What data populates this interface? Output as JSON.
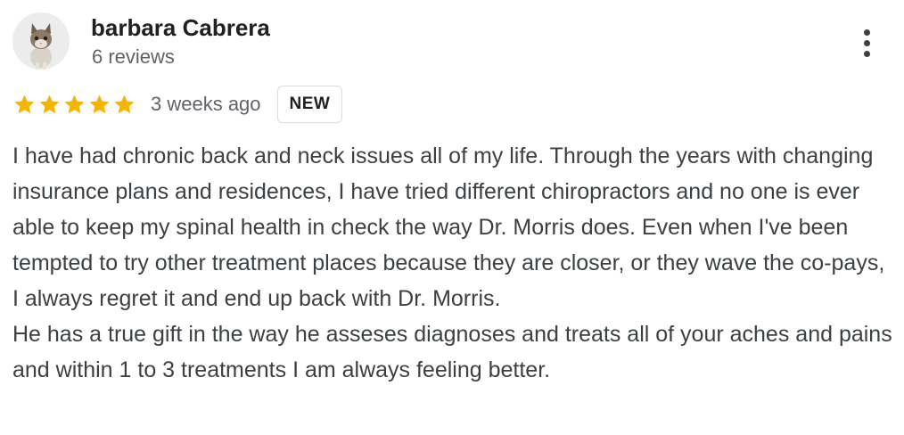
{
  "reviewer": {
    "name": "barbara Cabrera",
    "review_count": "6 reviews",
    "avatar_icon": "kitten-avatar"
  },
  "rating": {
    "stars": 5,
    "max_stars": 5,
    "star_color": "#f4b400",
    "time_ago": "3 weeks ago",
    "badge": "NEW"
  },
  "menu_icon": "more-vert-icon",
  "review": {
    "paragraph1": "I have had chronic back and neck issues all of my life. Through the years with changing insurance plans and residences, I have tried different chiropractors and no one is ever able to keep my spinal health in check the way Dr. Morris does. Even when I've been tempted to try other treatment places because they are closer, or they wave the co-pays, I always regret it and end up back with Dr. Morris.",
    "paragraph2": "He has a true gift in the way he asseses diagnoses and treats all of your aches and pains and within 1 to 3 treatments I am always feeling better."
  }
}
